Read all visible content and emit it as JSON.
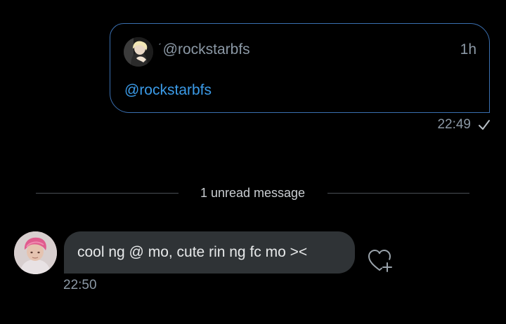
{
  "shared_tweet": {
    "avatar_icon": "profile-photo",
    "prefix": "ˊ",
    "handle": "@rockstarbfs",
    "time_ago": "1h",
    "body": "@rockstarbfs",
    "border_color": "#3a6fb0",
    "link_color": "#3b9be8"
  },
  "sent_message": {
    "time": "22:49",
    "status_icon": "check-icon"
  },
  "divider": {
    "label": "1 unread message"
  },
  "received_message": {
    "avatar_icon": "profile-photo",
    "text": "cool ng @ mo, cute rin ng fc mo ><",
    "time": "22:50",
    "reaction_icon": "heart-plus-icon",
    "bubble_color": "#2f3336"
  }
}
